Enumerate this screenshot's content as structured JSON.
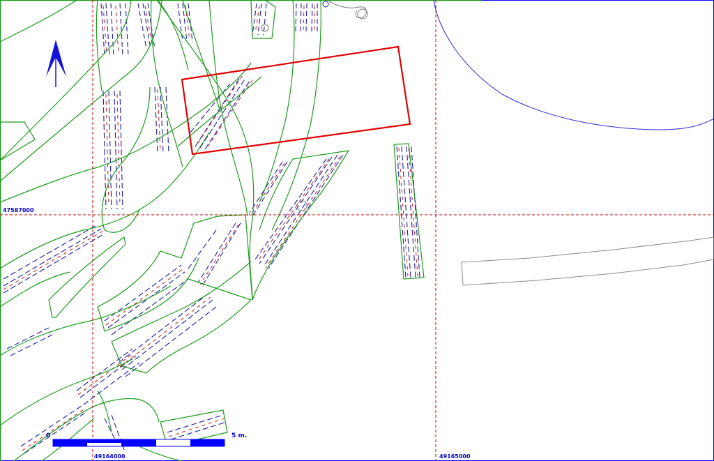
{
  "map": {
    "grid_labels": {
      "northing": "47587000",
      "easting_left": "49164000",
      "easting_right": "49165000"
    },
    "scale_bar": {
      "start_label": "0",
      "end_label": "5 m."
    },
    "colors": {
      "frame_blue": "#0000ff",
      "grid_red": "#cc0000",
      "highlight_red": "#e00000",
      "contour_green": "#1a9a1a",
      "survey_blue": "#1a1aaa",
      "shoreline_blue": "#2c2cd0",
      "outline_gray": "#8a8a8a",
      "label_blue": "#0000cc"
    },
    "north_arrow_icon": "north-arrow-icon"
  }
}
